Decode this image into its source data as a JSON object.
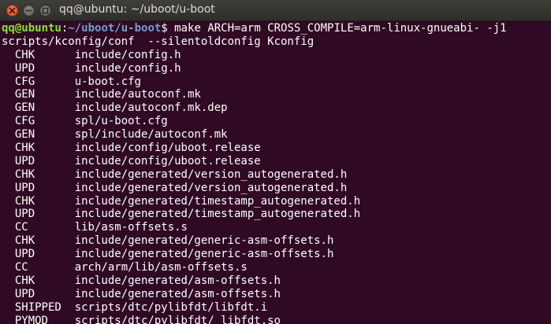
{
  "window": {
    "title": "qq@ubuntu: ~/uboot/u-boot"
  },
  "prompt": {
    "user_host": "qq@ubuntu",
    "colon": ":",
    "path": "~/uboot/u-boot",
    "symbol": "$ ",
    "command": "make ARCH=arm CROSS_COMPILE=arm-linux-gnueabi- -j1"
  },
  "output_first_line": "scripts/kconfig/conf  --silentoldconfig Kconfig",
  "build_lines": [
    {
      "tag": "CHK",
      "file": "include/config.h"
    },
    {
      "tag": "UPD",
      "file": "include/config.h"
    },
    {
      "tag": "CFG",
      "file": "u-boot.cfg"
    },
    {
      "tag": "GEN",
      "file": "include/autoconf.mk"
    },
    {
      "tag": "GEN",
      "file": "include/autoconf.mk.dep"
    },
    {
      "tag": "CFG",
      "file": "spl/u-boot.cfg"
    },
    {
      "tag": "GEN",
      "file": "spl/include/autoconf.mk"
    },
    {
      "tag": "CHK",
      "file": "include/config/uboot.release"
    },
    {
      "tag": "UPD",
      "file": "include/config/uboot.release"
    },
    {
      "tag": "CHK",
      "file": "include/generated/version_autogenerated.h"
    },
    {
      "tag": "UPD",
      "file": "include/generated/version_autogenerated.h"
    },
    {
      "tag": "CHK",
      "file": "include/generated/timestamp_autogenerated.h"
    },
    {
      "tag": "UPD",
      "file": "include/generated/timestamp_autogenerated.h"
    },
    {
      "tag": "CC",
      "file": "lib/asm-offsets.s"
    },
    {
      "tag": "CHK",
      "file": "include/generated/generic-asm-offsets.h"
    },
    {
      "tag": "UPD",
      "file": "include/generated/generic-asm-offsets.h"
    },
    {
      "tag": "CC",
      "file": "arch/arm/lib/asm-offsets.s"
    },
    {
      "tag": "CHK",
      "file": "include/generated/asm-offsets.h"
    },
    {
      "tag": "UPD",
      "file": "include/generated/asm-offsets.h"
    },
    {
      "tag": "SHIPPED",
      "file": "scripts/dtc/pylibfdt/libfdt.i"
    },
    {
      "tag": "PYMOD",
      "file": "scripts/dtc/pylibfdt/_libfdt.so"
    }
  ],
  "icons": {
    "close": "close-icon",
    "minimize": "minimize-icon",
    "maximize": "maximize-icon"
  },
  "colors": {
    "terminal_background": "#300a24",
    "prompt_user": "#8ae234",
    "prompt_path": "#729fcf",
    "close_button": "#df4a16"
  }
}
